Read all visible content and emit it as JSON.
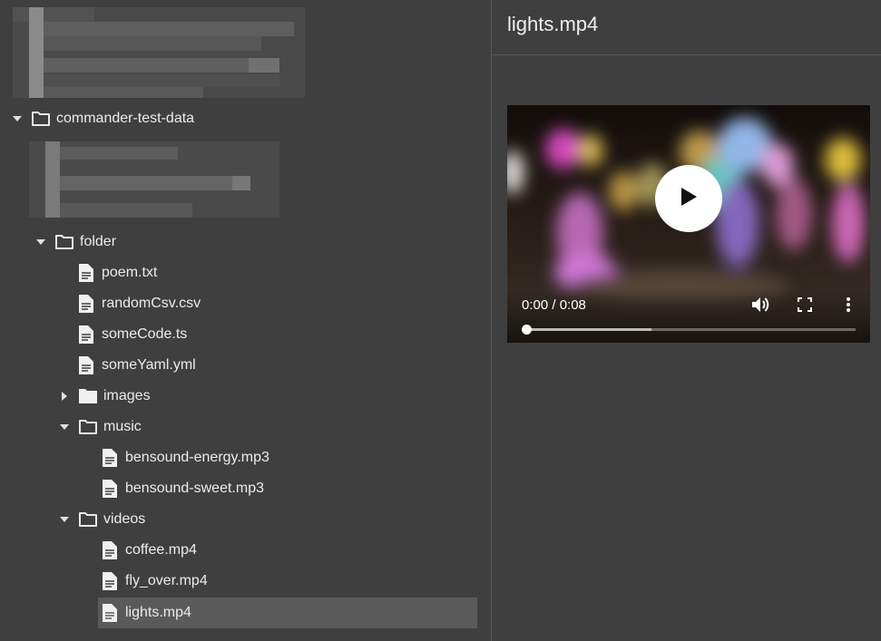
{
  "tree": {
    "items": [
      {
        "label": "commander-test-data",
        "type": "folder",
        "state": "expanded",
        "depth": 0
      },
      {
        "label": "folder",
        "type": "folder",
        "state": "expanded",
        "depth": 1
      },
      {
        "label": "poem.txt",
        "type": "file",
        "depth": 2
      },
      {
        "label": "randomCsv.csv",
        "type": "file",
        "depth": 2
      },
      {
        "label": "someCode.ts",
        "type": "file",
        "depth": 2
      },
      {
        "label": "someYaml.yml",
        "type": "file",
        "depth": 2
      },
      {
        "label": "images",
        "type": "folder",
        "state": "collapsed",
        "depth": 2
      },
      {
        "label": "music",
        "type": "folder",
        "state": "expanded",
        "depth": 2
      },
      {
        "label": "bensound-energy.mp3",
        "type": "file",
        "depth": 3
      },
      {
        "label": "bensound-sweet.mp3",
        "type": "file",
        "depth": 3
      },
      {
        "label": "videos",
        "type": "folder",
        "state": "expanded",
        "depth": 2
      },
      {
        "label": "coffee.mp4",
        "type": "file",
        "depth": 3
      },
      {
        "label": "fly_over.mp4",
        "type": "file",
        "depth": 3
      },
      {
        "label": "lights.mp4",
        "type": "file",
        "depth": 3,
        "selected": true
      }
    ]
  },
  "preview": {
    "title": "lights.mp4",
    "player": {
      "time": "0:00 / 0:08",
      "buffered_fraction": 0.38,
      "played_fraction": 0.0
    }
  },
  "icons": {
    "folder_open": "folder-outline-icon",
    "folder_closed": "folder-filled-icon",
    "file": "file-document-icon",
    "play": "play-icon",
    "volume": "volume-icon",
    "fullscreen": "fullscreen-icon",
    "more": "more-vert-icon"
  },
  "colors": {
    "background": "#3f3f3f",
    "selected_row": "#5a5a5a",
    "divider": "#5a5a5a",
    "text": "#ececec"
  }
}
